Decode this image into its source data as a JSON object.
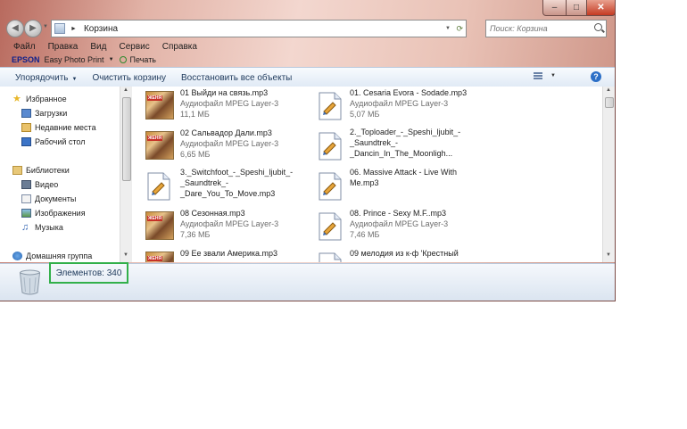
{
  "window": {
    "minimize_icon": "minimize-icon",
    "maximize_icon": "maximize-icon",
    "close_icon": "close-icon",
    "min_glyph": "–",
    "max_glyph": "□",
    "close_glyph": "✕"
  },
  "nav": {
    "back_glyph": "◀",
    "forward_glyph": "▶",
    "dropdown_glyph": "▼",
    "address_separator": "►",
    "address": "Корзина",
    "address_dropdown": "▼",
    "refresh_glyph": "⟳",
    "search_placeholder": "Поиск: Корзина"
  },
  "menu": [
    "Файл",
    "Правка",
    "Вид",
    "Сервис",
    "Справка"
  ],
  "epson": {
    "logo": "EPSON",
    "app": "Easy Photo Print",
    "dropdown": "▼",
    "print": "Печать"
  },
  "toolbar": {
    "organize": "Упорядочить",
    "organize_dropdown": "▼",
    "empty_bin": "Очистить корзину",
    "restore_all": "Восстановить все объекты",
    "views_dropdown": "▼",
    "help": "?"
  },
  "sidebar": {
    "items": [
      {
        "label": "Избранное",
        "icon": "star-icon",
        "level": 0
      },
      {
        "label": "Загрузки",
        "icon": "downloads-folder-icon",
        "level": 1
      },
      {
        "label": "Недавние места",
        "icon": "recent-places-icon",
        "level": 1
      },
      {
        "label": "Рабочий стол",
        "icon": "desktop-icon",
        "level": 1
      },
      {
        "label": "Библиотеки",
        "icon": "libraries-icon",
        "level": 0
      },
      {
        "label": "Видео",
        "icon": "video-library-icon",
        "level": 1
      },
      {
        "label": "Документы",
        "icon": "documents-library-icon",
        "level": 1
      },
      {
        "label": "Изображения",
        "icon": "pictures-library-icon",
        "level": 1
      },
      {
        "label": "Музыка",
        "icon": "music-library-icon",
        "level": 1
      },
      {
        "label": "Домашняя группа",
        "icon": "homegroup-icon",
        "level": 0
      }
    ],
    "scroll_up": "▲",
    "scroll_down": "▼"
  },
  "files": [
    {
      "name": "01 Выйди на связь.mp3",
      "type": "Аудиофайл MPEG Layer-3",
      "size": "11,1 МБ",
      "icon": "album-art-icon",
      "badge": "ЖЕНЯ"
    },
    {
      "name": "01. Cesaria Evora - Sodade.mp3",
      "type": "Аудиофайл MPEG Layer-3",
      "size": "5,07 МБ",
      "icon": "audio-file-icon"
    },
    {
      "name": "02 Сальвадор Дали.mp3",
      "type": "Аудиофайл MPEG Layer-3",
      "size": "6,65 МБ",
      "icon": "album-art-icon",
      "badge": "ЖЕНЯ"
    },
    {
      "name": "2._Toploader_-_Speshi_ljubit_-_Saundtrek_-_Dancin_In_The_Moonligh...",
      "type": "",
      "size": "",
      "icon": "audio-file-icon"
    },
    {
      "name": "3._Switchfoot_-_Speshi_ljubit_-_Saundtrek_-_Dare_You_To_Move.mp3",
      "type": "",
      "size": "",
      "icon": "audio-file-icon"
    },
    {
      "name": "06. Massive Attack - Live With Me.mp3",
      "type": "",
      "size": "",
      "icon": "audio-file-icon"
    },
    {
      "name": "08 Сезонная.mp3",
      "type": "Аудиофайл MPEG Layer-3",
      "size": "7,36 МБ",
      "icon": "album-art-icon",
      "badge": "ЖЕНЯ"
    },
    {
      "name": "08. Prince - Sexy M.F..mp3",
      "type": "Аудиофайл MPEG Layer-3",
      "size": "7,46 МБ",
      "icon": "audio-file-icon"
    },
    {
      "name": "09 Ее звали Америка.mp3",
      "type": "",
      "size": "",
      "icon": "album-art-icon",
      "badge": "ЖЕНЯ"
    },
    {
      "name": "09 мелодия из к-ф 'Крестный",
      "type": "",
      "size": "",
      "icon": "audio-file-icon"
    }
  ],
  "content_scroll": {
    "up": "▲",
    "down": "▼"
  },
  "details": {
    "bin_icon": "recycle-bin-icon",
    "status": "Элементов: 340"
  }
}
